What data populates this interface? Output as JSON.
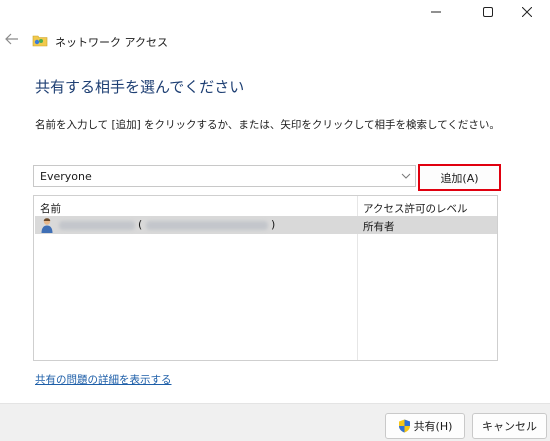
{
  "window": {
    "title": "ネットワーク アクセス",
    "controls": [
      "minimize",
      "maximize",
      "close"
    ]
  },
  "dialog": {
    "heading": "共有する相手を選んでください",
    "instruction": "名前を入力して [追加] をクリックするか、または、矢印をクリックして相手を検索してください。",
    "combo_value": "Everyone",
    "add_button": "追加(A)"
  },
  "table": {
    "columns": [
      "名前",
      "アクセス許可のレベル"
    ],
    "rows": [
      {
        "name_open": "(",
        "name_close": ")",
        "level": "所有者"
      }
    ]
  },
  "link": "共有の問題の詳細を表示する",
  "footer": {
    "share_button": "共有(H)",
    "cancel_button": "キャンセル"
  },
  "colors": {
    "heading": "#1e3f73",
    "link": "#1d5ea8",
    "highlight_border": "#e0000f",
    "selected_row": "#d9d9d9"
  },
  "icons": [
    "back-arrow-icon",
    "network-share-icon",
    "chevron-down-icon",
    "user-icon",
    "uac-shield-icon"
  ]
}
